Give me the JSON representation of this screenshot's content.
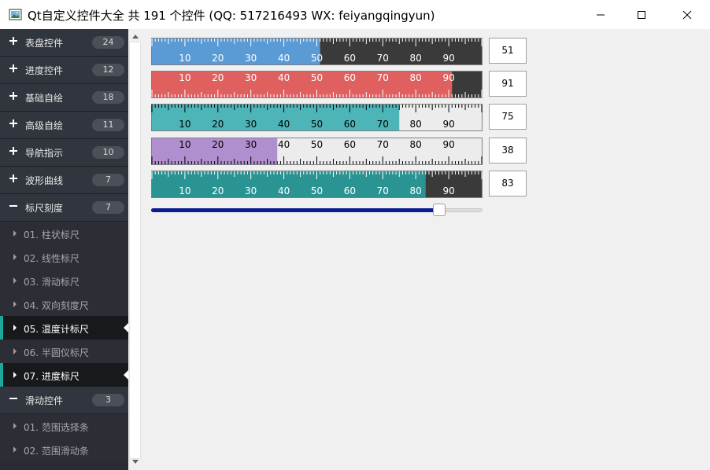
{
  "window": {
    "title": "Qt自定义控件大全 共 191 个控件 (QQ: 517216493 WX: feiyangqingyun)",
    "app_icon": "image-icon",
    "controls": [
      "minimize-icon",
      "maximize-icon",
      "close-icon"
    ]
  },
  "sidebar": {
    "categories": [
      {
        "label": "表盘控件",
        "count": "24",
        "sign": "+"
      },
      {
        "label": "进度控件",
        "count": "12",
        "sign": "+"
      },
      {
        "label": "基础自绘",
        "count": "18",
        "sign": "+"
      },
      {
        "label": "高级自绘",
        "count": "11",
        "sign": "+"
      },
      {
        "label": "导航指示",
        "count": "10",
        "sign": "+"
      },
      {
        "label": "波形曲线",
        "count": "7",
        "sign": "+"
      },
      {
        "label": "标尺刻度",
        "count": "7",
        "sign": "−"
      },
      {
        "label": "滑动控件",
        "count": "3",
        "sign": "−"
      }
    ],
    "ruler_items": [
      {
        "label": "01. 柱状标尺",
        "active": false
      },
      {
        "label": "02. 线性标尺",
        "active": false
      },
      {
        "label": "03. 滑动标尺",
        "active": false
      },
      {
        "label": "04. 双向刻度尺",
        "active": false
      },
      {
        "label": "05. 温度计标尺",
        "active": true
      },
      {
        "label": "06. 半圆仪标尺",
        "active": false
      },
      {
        "label": "07. 进度标尺",
        "active": true
      }
    ],
    "slider_items": [
      {
        "label": "01. 范围选择条",
        "active": false
      },
      {
        "label": "02. 范围滑动条",
        "active": false
      }
    ],
    "accent_color": "#19a89a"
  },
  "rulers": [
    {
      "value": "51",
      "fill_value": 51,
      "fill_color": "#5b9bd5",
      "bg_color": "#3a3a3a",
      "fill_text": "#ffffff",
      "bg_text": "#ffffff",
      "tick_color_fill": "#ffffff",
      "tick_color_bg": "#ffffff",
      "ticks_top": true,
      "labels": [
        "10",
        "20",
        "30",
        "40",
        "50",
        "60",
        "70",
        "80",
        "90"
      ]
    },
    {
      "value": "91",
      "fill_value": 91,
      "fill_color": "#e06060",
      "bg_color": "#3a3a3a",
      "fill_text": "#ffffff",
      "bg_text": "#ffffff",
      "tick_color_fill": "#ffffff",
      "tick_color_bg": "#ffffff",
      "ticks_top": false,
      "labels": [
        "10",
        "20",
        "30",
        "40",
        "50",
        "60",
        "70",
        "80",
        "90"
      ]
    },
    {
      "value": "75",
      "fill_value": 75,
      "fill_color": "#4db5b8",
      "bg_color": "#ececec",
      "fill_text": "#000000",
      "bg_text": "#000000",
      "tick_color_fill": "#000000",
      "tick_color_bg": "#000000",
      "ticks_top": true,
      "labels": [
        "10",
        "20",
        "30",
        "40",
        "50",
        "60",
        "70",
        "80",
        "90"
      ]
    },
    {
      "value": "38",
      "fill_value": 38,
      "fill_color": "#b08fcf",
      "bg_color": "#ececec",
      "fill_text": "#000000",
      "bg_text": "#000000",
      "tick_color_fill": "#000000",
      "tick_color_bg": "#000000",
      "ticks_top": false,
      "labels": [
        "10",
        "20",
        "30",
        "40",
        "50",
        "60",
        "70",
        "80",
        "90"
      ]
    },
    {
      "value": "83",
      "fill_value": 83,
      "fill_color": "#2a9493",
      "bg_color": "#3a3a3a",
      "fill_text": "#ffffff",
      "bg_text": "#ffffff",
      "tick_color_fill": "#ffffff",
      "tick_color_bg": "#ffffff",
      "ticks_top": true,
      "labels": [
        "10",
        "20",
        "30",
        "40",
        "50",
        "60",
        "70",
        "80",
        "90"
      ]
    }
  ],
  "slider": {
    "value": 87,
    "fill_color": "#0c1b8f"
  }
}
